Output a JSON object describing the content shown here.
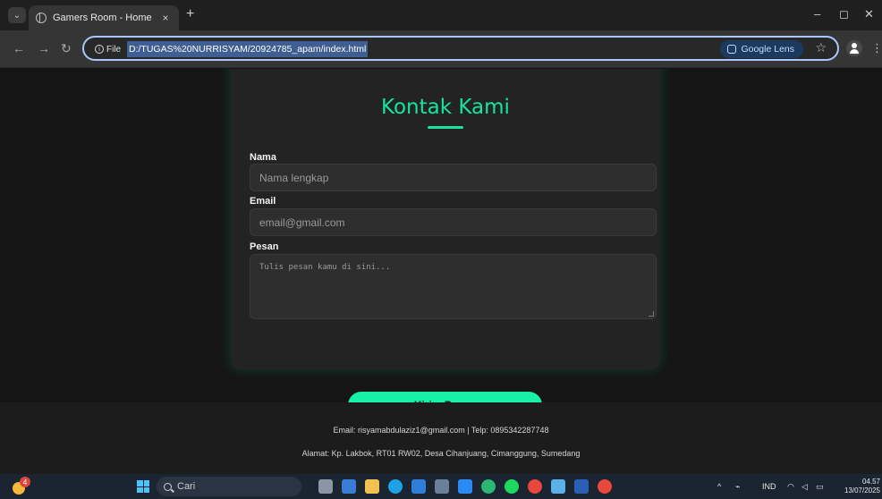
{
  "browser": {
    "tab_title": "Gamers Room - Home",
    "tab_close": "×",
    "new_tab": "+",
    "file_label": "File",
    "url": "D:/TUGAS%20NURRISYAM/20924785_apam/index.html",
    "lens_label": "Google Lens"
  },
  "contact": {
    "title": "Kontak Kami",
    "name_label": "Nama",
    "name_placeholder": "Nama lengkap",
    "email_label": "Email",
    "email_placeholder": "email@gmail.com",
    "message_label": "Pesan",
    "message_placeholder": "Tulis pesan kamu di sini...",
    "submit_label": "Kirim Pesan"
  },
  "footer": {
    "contact_line": "Email: risyamabdulaziz1@gmail.com | Telp: 0895342287748",
    "address_line": "Alamat: Kp. Lakbok, RT01 RW02, Desa Cihanjuang, Cimanggung, Sumedang"
  },
  "taskbar": {
    "weather_badge": "4",
    "search_label": "Cari",
    "language": "IND",
    "time": "04.57",
    "date": "13/07/2025"
  },
  "colors": {
    "accent": "#17e3a0",
    "button": "#17f0a6",
    "card": "#232323",
    "background": "#151515"
  }
}
